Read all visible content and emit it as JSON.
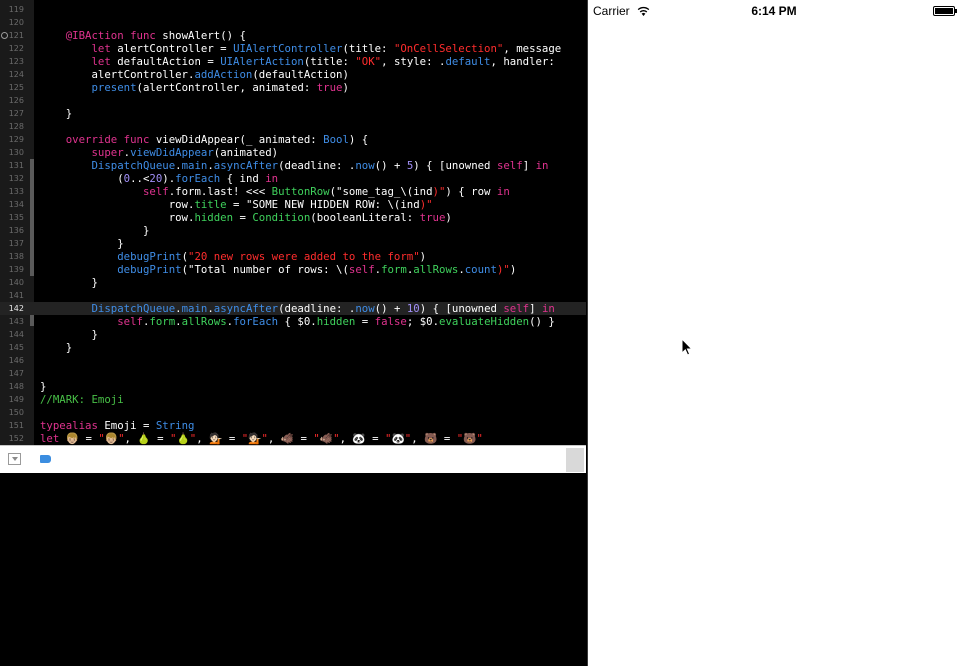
{
  "editor": {
    "lines": [
      {
        "num": "119",
        "tokens": []
      },
      {
        "num": "120",
        "tokens": []
      },
      {
        "num": "121",
        "breakpoint": true,
        "tokens": [
          [
            "    ",
            ""
          ],
          [
            "@IBAction",
            "kw"
          ],
          [
            " ",
            ""
          ],
          [
            "func",
            "kw"
          ],
          [
            " showAlert() {",
            ""
          ]
        ]
      },
      {
        "num": "122",
        "tokens": [
          [
            "        ",
            ""
          ],
          [
            "let",
            "kw"
          ],
          [
            " alertController = ",
            ""
          ],
          [
            "UIAlertController",
            "ty"
          ],
          [
            "(title: ",
            ""
          ],
          [
            "\"OnCellSelection\"",
            "st"
          ],
          [
            ", message",
            ""
          ]
        ]
      },
      {
        "num": "123",
        "tokens": [
          [
            "        ",
            ""
          ],
          [
            "let",
            "kw"
          ],
          [
            " defaultAction = ",
            ""
          ],
          [
            "UIAlertAction",
            "ty"
          ],
          [
            "(title: ",
            ""
          ],
          [
            "\"OK\"",
            "st"
          ],
          [
            ", style: .",
            ""
          ],
          [
            "default",
            "ty"
          ],
          [
            ", handler:",
            ""
          ]
        ]
      },
      {
        "num": "124",
        "tokens": [
          [
            "        alertController.",
            ""
          ],
          [
            "addAction",
            "ty"
          ],
          [
            "(defaultAction)",
            ""
          ]
        ]
      },
      {
        "num": "125",
        "tokens": [
          [
            "        ",
            ""
          ],
          [
            "present",
            "ty"
          ],
          [
            "(alertController, animated: ",
            ""
          ],
          [
            "true",
            "kw"
          ],
          [
            ")",
            ""
          ]
        ]
      },
      {
        "num": "126",
        "tokens": []
      },
      {
        "num": "127",
        "tokens": [
          [
            "    }",
            ""
          ]
        ]
      },
      {
        "num": "128",
        "tokens": []
      },
      {
        "num": "129",
        "tokens": [
          [
            "    ",
            ""
          ],
          [
            "override",
            "kw"
          ],
          [
            " ",
            ""
          ],
          [
            "func",
            "kw"
          ],
          [
            " viewDidAppear(_ animated: ",
            ""
          ],
          [
            "Bool",
            "ty"
          ],
          [
            ") {",
            ""
          ]
        ]
      },
      {
        "num": "130",
        "tokens": [
          [
            "        ",
            ""
          ],
          [
            "super",
            "kw"
          ],
          [
            ".",
            ""
          ],
          [
            "viewDidAppear",
            "ty"
          ],
          [
            "(animated)",
            ""
          ]
        ]
      },
      {
        "num": "131",
        "tokens": [
          [
            "        ",
            ""
          ],
          [
            "DispatchQueue",
            "ty"
          ],
          [
            ".",
            ""
          ],
          [
            "main",
            "ty"
          ],
          [
            ".",
            ""
          ],
          [
            "asyncAfter",
            "ty"
          ],
          [
            "(deadline: .",
            ""
          ],
          [
            "now",
            "ty"
          ],
          [
            "() + ",
            ""
          ],
          [
            "5",
            "nu"
          ],
          [
            ") { [unowned ",
            ""
          ],
          [
            "self",
            "kw"
          ],
          [
            "] ",
            ""
          ],
          [
            "in",
            "kw"
          ]
        ]
      },
      {
        "num": "132",
        "tokens": [
          [
            "            (",
            ""
          ],
          [
            "0",
            "nu"
          ],
          [
            "..<",
            ""
          ],
          [
            "20",
            "nu"
          ],
          [
            ").",
            ""
          ],
          [
            "forEach",
            "ty"
          ],
          [
            " { ind ",
            ""
          ],
          [
            "in",
            "kw"
          ]
        ]
      },
      {
        "num": "133",
        "tokens": [
          [
            "                ",
            ""
          ],
          [
            "self",
            "kw"
          ],
          [
            ".form.last! <<< ",
            ""
          ],
          [
            "ButtonRow",
            "fn"
          ],
          [
            "(",
            ""
          ],
          [
            "\"some_tag_\\(",
            ""
          ],
          [
            "ind",
            ""
          ],
          [
            ")\"",
            "st"
          ],
          [
            ") { row ",
            ""
          ],
          [
            "in",
            "kw"
          ]
        ]
      },
      {
        "num": "134",
        "tokens": [
          [
            "                    row.",
            ""
          ],
          [
            "title",
            "fn"
          ],
          [
            " = ",
            ""
          ],
          [
            "\"SOME NEW HIDDEN ROW: \\(",
            ""
          ],
          [
            "ind",
            ""
          ],
          [
            ")\"",
            "st"
          ]
        ]
      },
      {
        "num": "135",
        "tokens": [
          [
            "                    row.",
            ""
          ],
          [
            "hidden",
            "fn"
          ],
          [
            " = ",
            ""
          ],
          [
            "Condition",
            "fn"
          ],
          [
            "(booleanLiteral: ",
            ""
          ],
          [
            "true",
            "kw"
          ],
          [
            ")",
            ""
          ]
        ]
      },
      {
        "num": "136",
        "tokens": [
          [
            "                }",
            ""
          ]
        ]
      },
      {
        "num": "137",
        "tokens": [
          [
            "            }",
            ""
          ]
        ]
      },
      {
        "num": "138",
        "tokens": [
          [
            "            ",
            ""
          ],
          [
            "debugPrint",
            "ty"
          ],
          [
            "(",
            ""
          ],
          [
            "\"20 new rows were added to the form\"",
            "st"
          ],
          [
            ")",
            ""
          ]
        ]
      },
      {
        "num": "139",
        "tokens": [
          [
            "            ",
            ""
          ],
          [
            "debugPrint",
            "ty"
          ],
          [
            "(",
            ""
          ],
          [
            "\"Total number of rows: \\(",
            ""
          ],
          [
            "self",
            "kw"
          ],
          [
            ".",
            ""
          ],
          [
            "form",
            "fn"
          ],
          [
            ".",
            ""
          ],
          [
            "allRows",
            "fn"
          ],
          [
            ".",
            ""
          ],
          [
            "count",
            "ty"
          ],
          [
            ")\"",
            "st"
          ],
          [
            ")",
            ""
          ]
        ]
      },
      {
        "num": "140",
        "tokens": [
          [
            "        }",
            ""
          ]
        ]
      },
      {
        "num": "141",
        "tokens": []
      },
      {
        "num": "142",
        "current": true,
        "tokens": [
          [
            "        ",
            ""
          ],
          [
            "DispatchQueue",
            "ty"
          ],
          [
            ".",
            ""
          ],
          [
            "main",
            "ty"
          ],
          [
            ".",
            ""
          ],
          [
            "asyncAfter",
            "ty"
          ],
          [
            "(deadline: .",
            ""
          ],
          [
            "now",
            "ty"
          ],
          [
            "() + ",
            ""
          ],
          [
            "10",
            "nu"
          ],
          [
            ") { [unowned ",
            ""
          ],
          [
            "self",
            "kw"
          ],
          [
            "] ",
            ""
          ],
          [
            "in",
            "kw"
          ]
        ]
      },
      {
        "num": "143",
        "tokens": [
          [
            "            ",
            ""
          ],
          [
            "self",
            "kw"
          ],
          [
            ".",
            ""
          ],
          [
            "form",
            "fn"
          ],
          [
            ".",
            ""
          ],
          [
            "allRows",
            "fn"
          ],
          [
            ".",
            ""
          ],
          [
            "forEach",
            "ty"
          ],
          [
            " { $0.",
            ""
          ],
          [
            "hidden",
            "fn"
          ],
          [
            " = ",
            ""
          ],
          [
            "false",
            "kw"
          ],
          [
            "; $0.",
            ""
          ],
          [
            "evaluateHidden",
            "fn"
          ],
          [
            "() }",
            ""
          ]
        ]
      },
      {
        "num": "144",
        "tokens": [
          [
            "        }",
            ""
          ]
        ]
      },
      {
        "num": "145",
        "tokens": [
          [
            "    }",
            ""
          ]
        ]
      },
      {
        "num": "146",
        "tokens": []
      },
      {
        "num": "147",
        "tokens": []
      },
      {
        "num": "148",
        "tokens": [
          [
            "}",
            ""
          ]
        ]
      },
      {
        "num": "149",
        "tokens": [
          [
            "//MARK: Emoji",
            "cm"
          ]
        ]
      },
      {
        "num": "150",
        "tokens": []
      },
      {
        "num": "151",
        "tokens": [
          [
            "typealias",
            "kw"
          ],
          [
            " Emoji = ",
            ""
          ],
          [
            "String",
            "ty"
          ]
        ]
      },
      {
        "num": "152",
        "tokens": [
          [
            "let",
            "kw"
          ],
          [
            " 👦🏼 = ",
            ""
          ],
          [
            "\"👦🏼\"",
            "st"
          ],
          [
            ", 🍐 = ",
            ""
          ],
          [
            "\"🍐\"",
            "st"
          ],
          [
            ", 💁🏻 = ",
            ""
          ],
          [
            "\"💁🏻\"",
            "st"
          ],
          [
            ", 🐗 = ",
            ""
          ],
          [
            "\"🐗\"",
            "st"
          ],
          [
            ", 🐼 = ",
            ""
          ],
          [
            "\"🐼\"",
            "st"
          ],
          [
            ", 🐻 = ",
            ""
          ],
          [
            "\"🐻\"",
            "st"
          ]
        ]
      }
    ]
  },
  "simulator": {
    "status_bar": {
      "carrier": "Carrier",
      "time": "6:14 PM"
    }
  },
  "icons": {
    "wifi": "wifi-icon",
    "battery": "battery-icon",
    "breakpoint": "breakpoint-icon",
    "debug_toggle": "hide-debug-area-icon",
    "tag": "tag-icon",
    "cursor": "mouse-pointer-icon"
  }
}
